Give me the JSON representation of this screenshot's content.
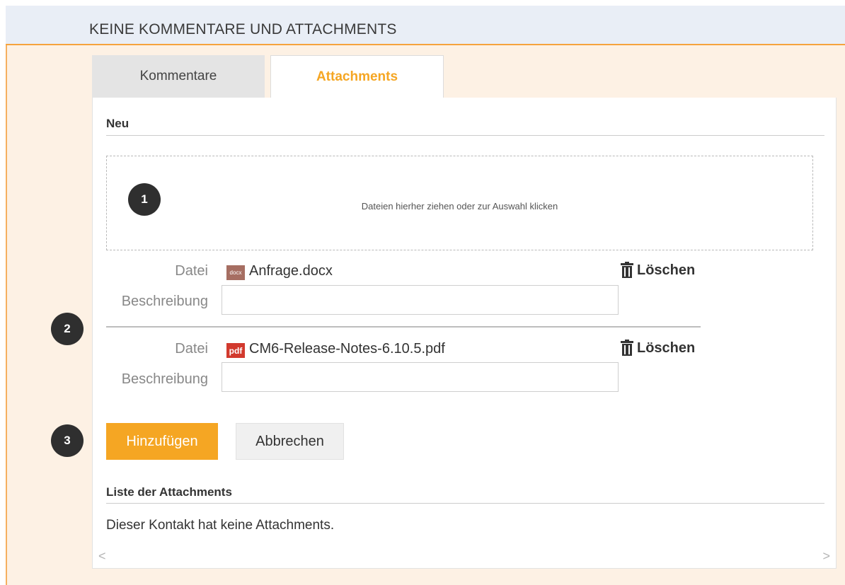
{
  "header": {
    "title": "KEINE KOMMENTARE UND ATTACHMENTS"
  },
  "tabs": [
    {
      "label": "Kommentare",
      "active": false
    },
    {
      "label": "Attachments",
      "active": true
    }
  ],
  "new_section": {
    "heading": "Neu"
  },
  "dropzone": {
    "text": "Dateien hierher ziehen oder zur Auswahl klicken"
  },
  "callouts": [
    "1",
    "2",
    "3"
  ],
  "files": [
    {
      "file_label": "Datei",
      "type_badge": "docx",
      "icon": "docx-file-icon",
      "name": "Anfrage.docx",
      "delete_label": "Löschen",
      "description_label": "Beschreibung",
      "description_value": ""
    },
    {
      "file_label": "Datei",
      "type_badge": "pdf",
      "icon": "pdf-file-icon",
      "name": "CM6-Release-Notes-6.10.5.pdf",
      "delete_label": "Löschen",
      "description_label": "Beschreibung",
      "description_value": ""
    }
  ],
  "actions": {
    "add_label": "Hinzufügen",
    "cancel_label": "Abbrechen"
  },
  "list_section": {
    "heading": "Liste der Attachments",
    "empty_text": "Dieser Kontakt hat keine Attachments."
  },
  "scrollbar": {
    "left_arrow": "<",
    "right_arrow": ">"
  },
  "colors": {
    "accent": "#f5a623",
    "header_bg": "#e9eef6",
    "area_bg": "#fdf1e4"
  }
}
